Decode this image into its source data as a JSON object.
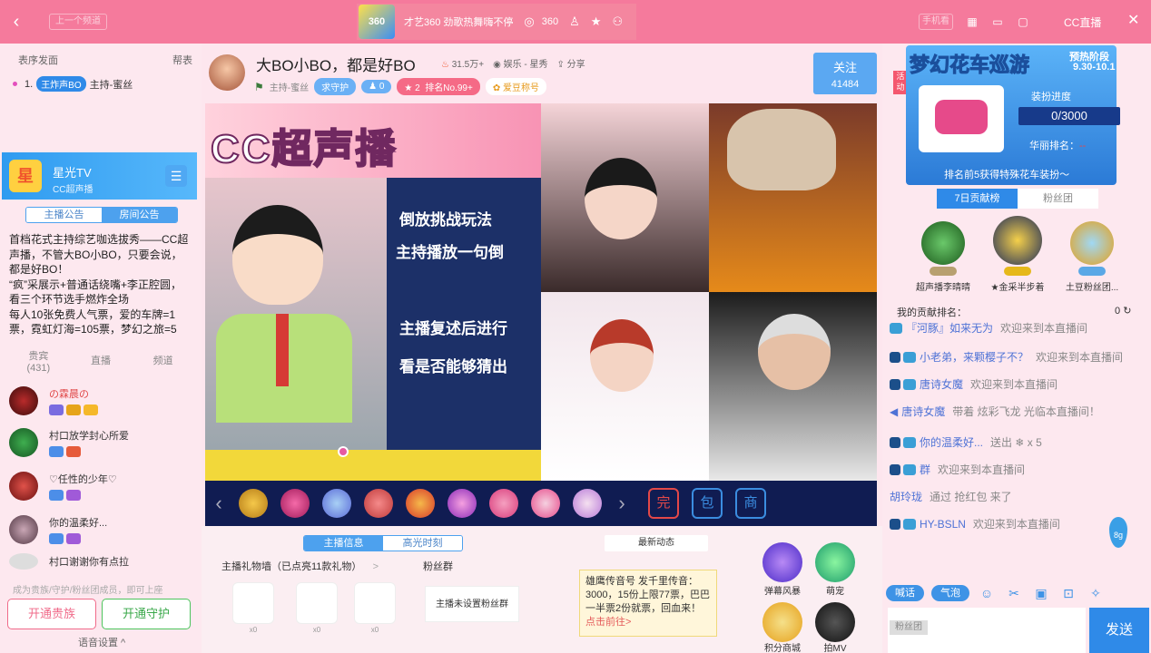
{
  "topbar": {
    "back": "‹",
    "prev_label": "上一个频道",
    "show_logo": "360",
    "show_name": "才艺360 劲歌热舞嗨不停",
    "show_count": "360",
    "phone_label": "手机看",
    "brand": "CC直播",
    "close": "✕"
  },
  "left": {
    "fan_label": "表序发面",
    "help": "帮表",
    "fan_rank": "1.",
    "fan_badge": "王炸声BO",
    "fan_host": "主持-蜜丝",
    "channel_title": "星光TV",
    "channel_sub": "CC超声播",
    "tab_host": "主播公告",
    "tab_room": "房间公告",
    "notice": "首档花式主持综艺咖选拔秀——CC超声播，不管大BO小BO，只要会说，都是好BO！\n“疯”采展示+普通话绕嘴+李正腔圆，看三个环节选手燃炸全场\n每人10张免费人气票，爱的车牌=1票，霓虹灯海=105票，梦幻之旅=5",
    "tab_guest": "贵宾",
    "guest_count": "(431)",
    "tab_live": "直播",
    "tab_channel": "频道",
    "guests": [
      {
        "name": "の霖晨の",
        "color": "red"
      },
      {
        "name": "村口放学封心所爱",
        "color": "normal"
      },
      {
        "name": "♡任性的少年♡",
        "color": "normal"
      },
      {
        "name": "你的温柔好...",
        "color": "normal"
      },
      {
        "name": "村口谢谢你有点拉",
        "color": "normal"
      }
    ],
    "hint": "成为贵族/守护/粉丝团成员，即可上座",
    "btn_noble": "开通贵族",
    "btn_guard": "开通守护",
    "voice": "语音设置 ^"
  },
  "header": {
    "title": "大BO小BO，都是好BO",
    "popularity": "31.5万+",
    "category": "娱乐 - 星秀",
    "share": "分享",
    "host": "主持-蜜丝",
    "guard_label": "求守护",
    "fans_count": "0",
    "rank_num": "2",
    "rank_label": "排名No.99+",
    "love_label": "爱豆称号",
    "follow": "关注",
    "follow_count": "41484"
  },
  "video": {
    "banner": "CC超声播",
    "rules": [
      "倒放挑战玩法",
      "主持播放一句倒",
      "主播复述后进行",
      "看是否能够猜出"
    ]
  },
  "gifts": {
    "prev": "‹",
    "next": "›",
    "side_labels": [
      "完",
      "包",
      "商"
    ]
  },
  "below": {
    "tab_info": "主播信息",
    "tab_high": "高光时刻",
    "wall": "主播礼物墙（已点亮11款礼物）",
    "wall_arrow": ">",
    "fans": "粉丝群",
    "nofan": "主播未设置粉丝群",
    "gift_counts": [
      "x0",
      "x0",
      "x0"
    ],
    "dyn_header": "最新动态",
    "dyn_text": "雄鹰传音号  发千里传音：3000，15份上限77票，巴巴一半票2份就票，回血来！",
    "dyn_link": "点击前往>",
    "acts": [
      "弹幕风暴",
      "萌宠",
      "积分商城",
      "拍MV"
    ]
  },
  "right": {
    "act_tag": "活动",
    "event_title": "梦幻花车巡游",
    "stage": "预热阶段",
    "dates": "9.30-10.1",
    "progress_label": "装扮进度",
    "progress": "0/3000",
    "rank_label": "华丽排名：",
    "rank_value": "--",
    "footer": "排名前5获得特殊花车装扮～",
    "tab_week": "7日贡献榜",
    "tab_fans": "粉丝团",
    "top3": [
      {
        "name": "超声播李晴晴",
        "lv": "S00K"
      },
      {
        "name": "★金采半步着",
        "lv": "201K"
      },
      {
        "name": "土豆粉丝团...",
        "lv": "58K"
      }
    ],
    "my_rank": "我的贡献排名：",
    "my_value": "0",
    "send": "发送",
    "input_placeholder": "粉丝团",
    "tool_chat": "喊话",
    "tool_bubble": "气泡",
    "drop": "8g"
  },
  "chat": [
    {
      "user": "『河豚』如来无为",
      "text": "欢迎来到本直播间",
      "ucolor": "u"
    },
    {
      "user": "小老弟，来颗樱子不？",
      "text": "欢迎来到本直播间",
      "ucolor": "u"
    },
    {
      "user": "唐诗女魔",
      "text": "欢迎来到本直播间",
      "ucolor": "u"
    },
    {
      "user": "唐诗女魔",
      "text": "带着 炫彩飞龙 光临本直播间！",
      "ucolor": "u"
    },
    {
      "user": "你的温柔好...",
      "text": "送出 ❄ x 5",
      "ucolor": "u"
    },
    {
      "user": "群",
      "text": "欢迎来到本直播间",
      "ucolor": "u"
    },
    {
      "user": "胡玲珑",
      "text": "通过 抢红包 来了",
      "ucolor": "y"
    },
    {
      "user": "HY-BSLN",
      "text": "欢迎来到本直播间",
      "ucolor": "u"
    }
  ],
  "colors": {
    "topbar": "#f57a9c",
    "accent": "#2f8ae8",
    "video_bg": "#0c1e58"
  }
}
